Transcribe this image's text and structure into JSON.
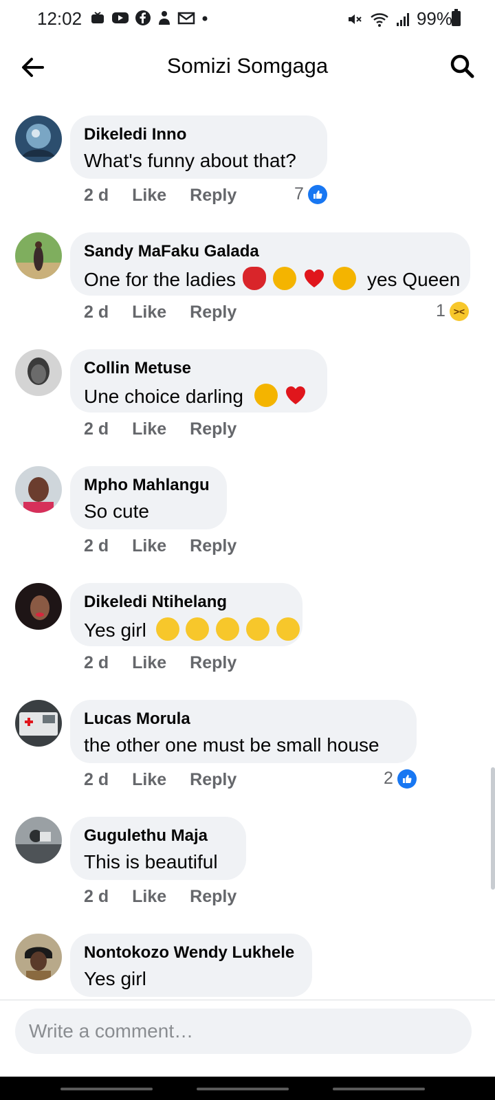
{
  "status_bar": {
    "time": "12:02",
    "battery": "99%",
    "app_icons": [
      "notification-icon",
      "youtube-icon",
      "facebook-icon",
      "person-icon",
      "gmail-icon",
      "dot-icon"
    ]
  },
  "header": {
    "title": "Somizi Somgaga"
  },
  "colors": {
    "bubble": "#f0f2f5",
    "like_blue": "#1877f2",
    "meta_gray": "#65676b"
  },
  "comments": [
    {
      "author": "Dikeledi Inno",
      "text": "What's funny about that?",
      "time": "2 d",
      "like": "Like",
      "reply": "Reply",
      "reaction_count": "7",
      "reaction": "like"
    },
    {
      "author": "Sandy MaFaku Galada",
      "text": "One for the ladies",
      "text_after": "yes Queen",
      "emojis": [
        "dancer",
        "ok-hand",
        "heart",
        "victory-hand"
      ],
      "time": "2 d",
      "like": "Like",
      "reply": "Reply",
      "reaction_count": "1",
      "reaction": "haha"
    },
    {
      "author": "Collin Metuse",
      "text": "Une choice darling",
      "emojis": [
        "clap",
        "heart"
      ],
      "time": "2 d",
      "like": "Like",
      "reply": "Reply"
    },
    {
      "author": "Mpho Mahlangu",
      "text": "So cute",
      "time": "2 d",
      "like": "Like",
      "reply": "Reply"
    },
    {
      "author": "Dikeledi Ntihelang",
      "text": "Yes girl",
      "emojis": [
        "joy",
        "sob",
        "sob",
        "joy",
        "smiling-hearts"
      ],
      "time": "2 d",
      "like": "Like",
      "reply": "Reply"
    },
    {
      "author": "Lucas Morula",
      "text": "the other one must be small house",
      "time": "2 d",
      "like": "Like",
      "reply": "Reply",
      "reaction_count": "2",
      "reaction": "like"
    },
    {
      "author": "Gugulethu Maja",
      "text": "This is beautiful",
      "time": "2 d",
      "like": "Like",
      "reply": "Reply"
    },
    {
      "author": "Nontokozo Wendy Lukhele",
      "text": "Yes girl"
    }
  ],
  "composer": {
    "placeholder": "Write a comment…"
  }
}
